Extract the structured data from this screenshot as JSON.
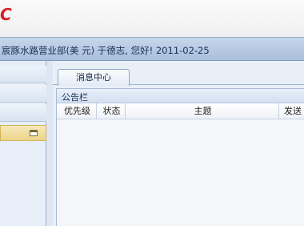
{
  "header": {
    "logo_left": "",
    "logo_right": "C"
  },
  "welcome": {
    "text": "宸豚水路营业部(美 元) 于德志, 您好! 2011-02-25"
  },
  "left_panel": {
    "active_item_icon": "window-icon"
  },
  "tabs": [
    {
      "label": "消息中心"
    }
  ],
  "bulletin": {
    "title": "公告栏",
    "columns": [
      "优先级",
      "状态",
      "主题",
      "发送"
    ]
  },
  "colors": {
    "brand_blue": "#0b1f6e",
    "brand_red": "#d62020",
    "welcome_bg": "#b8cbe3",
    "active_item": "#eed48a"
  }
}
